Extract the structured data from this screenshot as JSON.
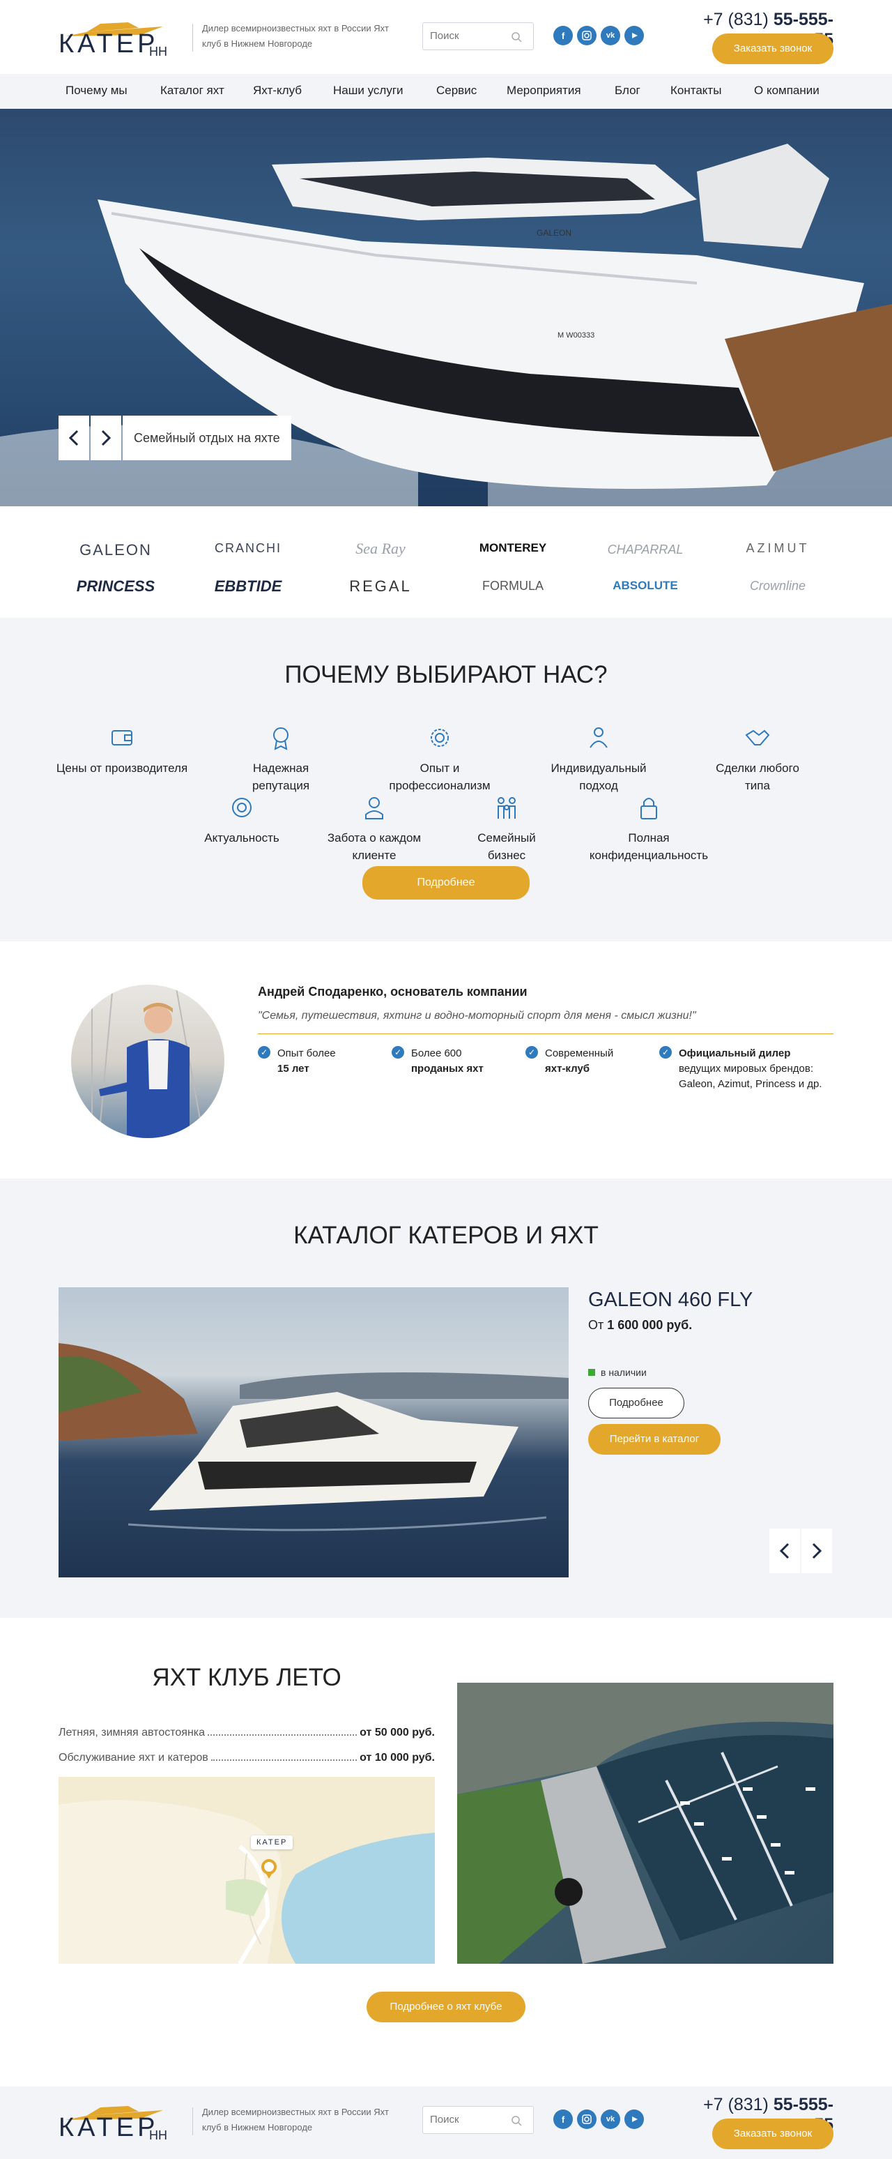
{
  "header": {
    "logo": "КАТЕР",
    "logo_suffix": "НН",
    "tagline": "Дилер всемирноизвестных яхт в России Яхт клуб в Нижнем Новгороде",
    "search_placeholder": "Поиск",
    "phone_code": "+7 (831)",
    "phone_number": "55-555-55",
    "callback": "Заказать звонок",
    "social": [
      "f",
      "ig",
      "vk",
      "yt"
    ]
  },
  "nav": [
    "Почему мы",
    "Каталог яхт",
    "Яхт-клуб",
    "Наши услуги",
    "Сервис",
    "Мероприятия",
    "Блог",
    "Контакты",
    "О компании"
  ],
  "hero": {
    "caption": "Семейный отдых на яхте",
    "boat_model": "GALEON",
    "boat_reg": "M W00333"
  },
  "brands": [
    "GALEON",
    "CRANCHI",
    "Sea Ray",
    "MONTEREY",
    "CHAPARRAL",
    "AZIMUT",
    "PRINCESS",
    "EBBTIDE",
    "REGAL",
    "FORMULA",
    "ABSOLUTE",
    "Crownline"
  ],
  "why": {
    "title": "ПОЧЕМУ ВЫБИРАЮТ НАС?",
    "items": [
      "Цены от производителя",
      "Надежная репутация",
      "Опыт и профессионализм",
      "Индивидуальный подход",
      "Сделки любого типа",
      "Актуальность",
      "Забота о каждом клиенте",
      "Семейный бизнес",
      "Полная конфиденциальность"
    ],
    "more": "Подробнее"
  },
  "founder": {
    "name": "Андрей Сподаренко, основатель компании",
    "quote": "\"Семья, путешествия, яхтинг и водно-моторный спорт для меня - смысл жизни!\"",
    "facts": [
      {
        "top": "Опыт более",
        "bold": "15 лет"
      },
      {
        "top": "Более 600",
        "bold": "проданых яхт"
      },
      {
        "top": "Современный",
        "bold": "яхт-клуб"
      },
      {
        "top": "Официальный дилер",
        "bold": "ведущих мировых брендов: Galeon, Azimut, Princess и др."
      }
    ]
  },
  "catalog": {
    "title": "КАТАЛОГ КАТЕРОВ И ЯХТ",
    "model": "GALEON 460 FLY",
    "price_prefix": "От",
    "price": "1 600 000 руб.",
    "availability": "в наличии",
    "details": "Подробнее",
    "go_catalog": "Перейти в каталог"
  },
  "club": {
    "title": "ЯХТ КЛУБ ЛЕТО",
    "services": [
      {
        "label": "Летняя, зимняя автостоянка",
        "price": "от 50 000 руб."
      },
      {
        "label": "Обслуживание яхт и катеров",
        "price": "от 10 000 руб."
      }
    ],
    "more": "Подробнее о яхт клубе",
    "map_logo": "КАТЕР"
  },
  "colors": {
    "accent": "#e3a72b",
    "navy": "#1e2a44",
    "social": "#2f79bd",
    "light_bg": "#f3f4f8"
  }
}
